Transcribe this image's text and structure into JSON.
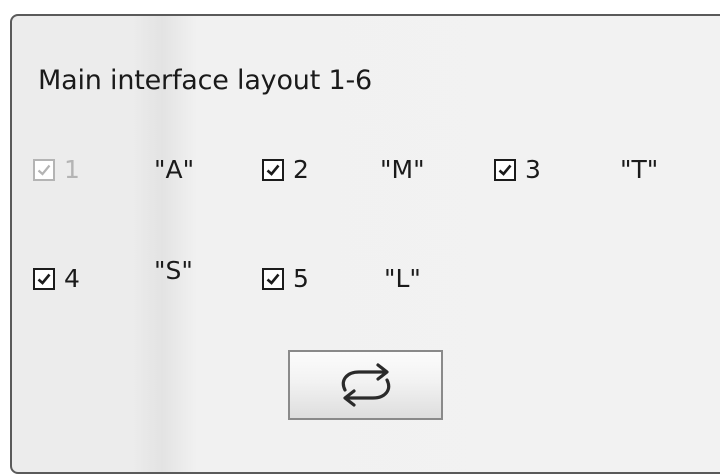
{
  "dialog": {
    "title": "Main interface layout 1-6"
  },
  "options": [
    {
      "number": "1",
      "code": "\"A\"",
      "checked": true,
      "enabled": false
    },
    {
      "number": "2",
      "code": "\"M\"",
      "checked": true,
      "enabled": true
    },
    {
      "number": "3",
      "code": "\"T\"",
      "checked": true,
      "enabled": true
    },
    {
      "number": "4",
      "code": "\"S\"",
      "checked": true,
      "enabled": true
    },
    {
      "number": "5",
      "code": "\"L\"",
      "checked": true,
      "enabled": true
    }
  ],
  "icons": {
    "checkmark": "check-icon",
    "swap": "swap-arrows-icon"
  },
  "colors": {
    "border": "#5a5a5a",
    "disabled": "#b4b4b4",
    "text": "#1a1a1a"
  }
}
